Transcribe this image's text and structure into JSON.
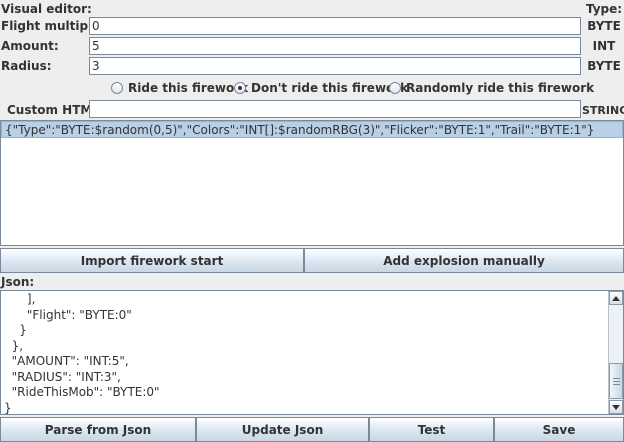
{
  "header": {
    "visual_editor_label": "Visual editor:",
    "type_label": "Type:"
  },
  "fields": [
    {
      "label": "Flight multiplier:",
      "value": "0",
      "type": "BYTE"
    },
    {
      "label": "Amount:",
      "value": "5",
      "type": "INT"
    },
    {
      "label": "Radius:",
      "value": "3",
      "type": "BYTE"
    }
  ],
  "ride_options": {
    "selected": "dont_ride",
    "items": [
      {
        "label": "Ride this firework"
      },
      {
        "label": "Don't ride this firework"
      },
      {
        "label": "Randomly ride this firework"
      }
    ]
  },
  "custom_html": {
    "label": "Custom HTML:",
    "value": "",
    "type": "STRING"
  },
  "explosions_list": [
    "{\"Type\":\"BYTE:$random(0,5)\",\"Colors\":\"INT[]:$randomRBG(3)\",\"Flicker\":\"BYTE:1\",\"Trail\":\"BYTE:1\"}"
  ],
  "buttons": {
    "import_start": "Import firework start",
    "add_explosion": "Add explosion manually"
  },
  "json_section": {
    "label": "Json:",
    "lines": [
      "      ],",
      "      \"Flight\": \"BYTE:0\"",
      "    }",
      "  },",
      "  \"AMOUNT\": \"INT:5\",",
      "  \"RADIUS\": \"INT:3\",",
      "  \"RideThisMob\": \"BYTE:0\"",
      "}"
    ]
  },
  "bottom_buttons": {
    "parse": "Parse from Json",
    "update": "Update Json",
    "test": "Test",
    "save": "Save"
  },
  "colors": {
    "selection": "#b8cfe5",
    "border": "#7a8a99",
    "background": "#eeeeee"
  }
}
